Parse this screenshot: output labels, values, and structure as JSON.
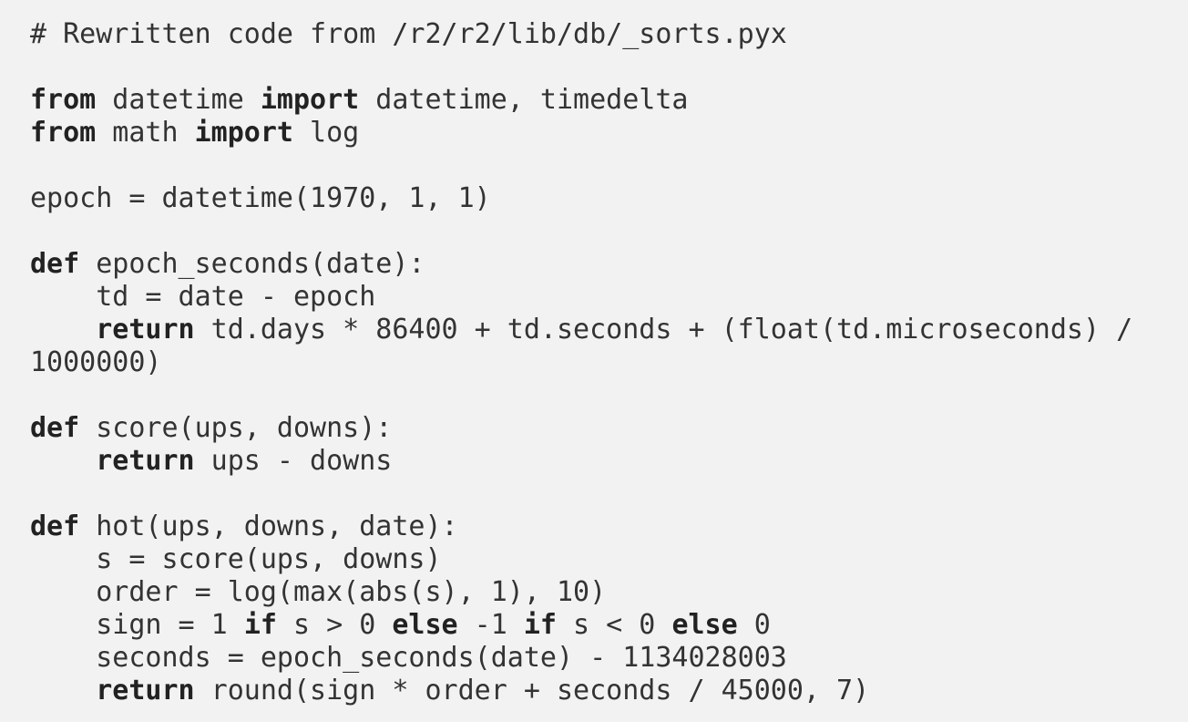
{
  "code": {
    "language": "python",
    "lines": [
      [
        {
          "t": "# Rewritten code from /r2/r2/lib/db/_sorts.pyx",
          "k": "comment"
        }
      ],
      [],
      [
        {
          "t": "from",
          "k": "kw"
        },
        {
          "t": " datetime "
        },
        {
          "t": "import",
          "k": "kw"
        },
        {
          "t": " datetime, timedelta"
        }
      ],
      [
        {
          "t": "from",
          "k": "kw"
        },
        {
          "t": " math "
        },
        {
          "t": "import",
          "k": "kw"
        },
        {
          "t": " log"
        }
      ],
      [],
      [
        {
          "t": "epoch = datetime(1970, 1, 1)"
        }
      ],
      [],
      [
        {
          "t": "def",
          "k": "kw"
        },
        {
          "t": " epoch_seconds(date):"
        }
      ],
      [
        {
          "t": "    td = date - epoch"
        }
      ],
      [
        {
          "t": "    "
        },
        {
          "t": "return",
          "k": "kw"
        },
        {
          "t": " td.days * 86400 + td.seconds + (float(td.microseconds) /"
        }
      ],
      [
        {
          "t": "1000000)"
        }
      ],
      [],
      [
        {
          "t": "def",
          "k": "kw"
        },
        {
          "t": " score(ups, downs):"
        }
      ],
      [
        {
          "t": "    "
        },
        {
          "t": "return",
          "k": "kw"
        },
        {
          "t": " ups - downs"
        }
      ],
      [],
      [
        {
          "t": "def",
          "k": "kw"
        },
        {
          "t": " hot(ups, downs, date):"
        }
      ],
      [
        {
          "t": "    s = score(ups, downs)"
        }
      ],
      [
        {
          "t": "    order = log(max(abs(s), 1), 10)"
        }
      ],
      [
        {
          "t": "    sign = 1 "
        },
        {
          "t": "if",
          "k": "kw"
        },
        {
          "t": " s > 0 "
        },
        {
          "t": "else",
          "k": "kw"
        },
        {
          "t": " -1 "
        },
        {
          "t": "if",
          "k": "kw"
        },
        {
          "t": " s < 0 "
        },
        {
          "t": "else",
          "k": "kw"
        },
        {
          "t": " 0"
        }
      ],
      [
        {
          "t": "    seconds = epoch_seconds(date) - 1134028003"
        }
      ],
      [
        {
          "t": "    "
        },
        {
          "t": "return",
          "k": "kw"
        },
        {
          "t": " round(sign * order + seconds / 45000, 7)"
        }
      ]
    ]
  }
}
